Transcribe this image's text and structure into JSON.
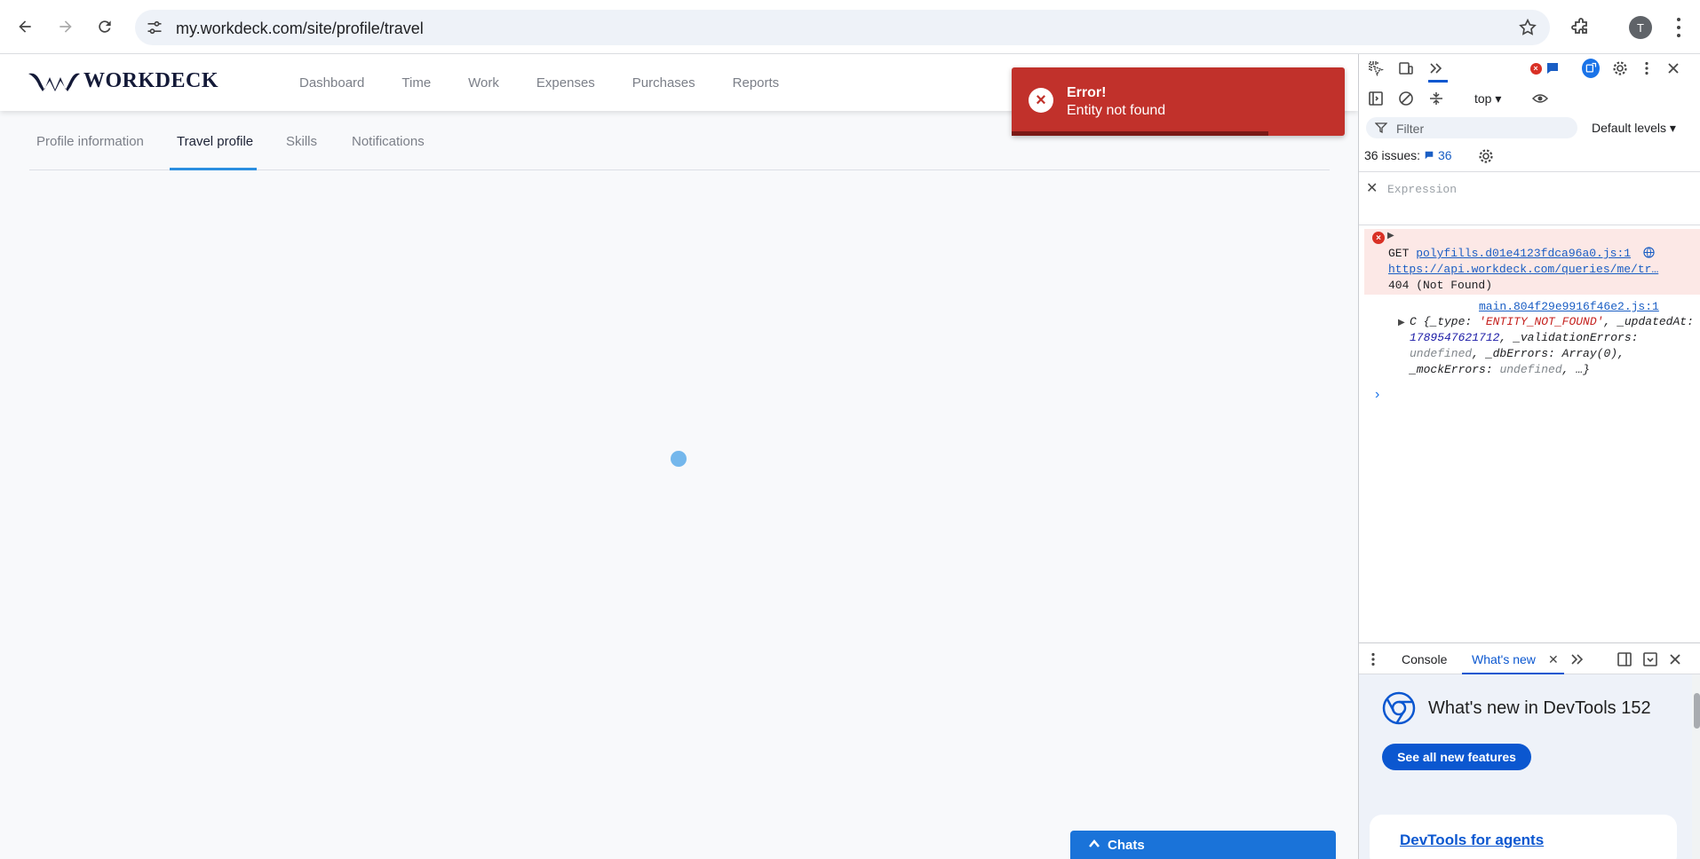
{
  "browser": {
    "url": "my.workdeck.com/site/profile/travel",
    "avatar_letter": "T"
  },
  "app": {
    "brand": "WORKDECK",
    "nav": [
      "Dashboard",
      "Time",
      "Work",
      "Expenses",
      "Purchases",
      "Reports"
    ],
    "tabs": [
      "Profile information",
      "Travel profile",
      "Skills",
      "Notifications"
    ],
    "active_tab": "Travel profile",
    "toast": {
      "title": "Error!",
      "message": "Entity not found",
      "progress": 0.77
    },
    "chats_label": "Chats"
  },
  "devtools": {
    "context": "top",
    "filter_placeholder": "Filter",
    "levels": "Default levels",
    "issues_label": "36 issues:",
    "issues_count": "36",
    "expression_placeholder": "Expression",
    "error": {
      "method": "GET",
      "source": "polyfills.d01e4123fdca96a0.js:1",
      "url": "https://api.workdeck.com/queries/me/tr…",
      "status": "404 (Not Found)"
    },
    "log_source": "main.804f29e9916f46e2.js:1",
    "object": {
      "prefix": "C {",
      "k1": "_type",
      "v1": "'ENTITY_NOT_FOUND'",
      "k2": "_updatedAt",
      "v2": "1789547621712",
      "k3": "_validationErrors",
      "v3": "undefined",
      "k4": "_dbErrors",
      "v4": "Array(0)",
      "k5": "_mockErrors",
      "v5": "undefined",
      "suffix": "…}"
    },
    "drawer_tabs": [
      "Console",
      "What's new"
    ],
    "whats_new_title": "What's new in DevTools 152",
    "see_all_button": "See all new features",
    "card_link": "DevTools for agents"
  },
  "colors": {
    "accent": "#2b8ee0",
    "toast_bg": "#c1312b",
    "chats_bg": "#1a73d9",
    "devtools_blue": "#0b57d0"
  }
}
